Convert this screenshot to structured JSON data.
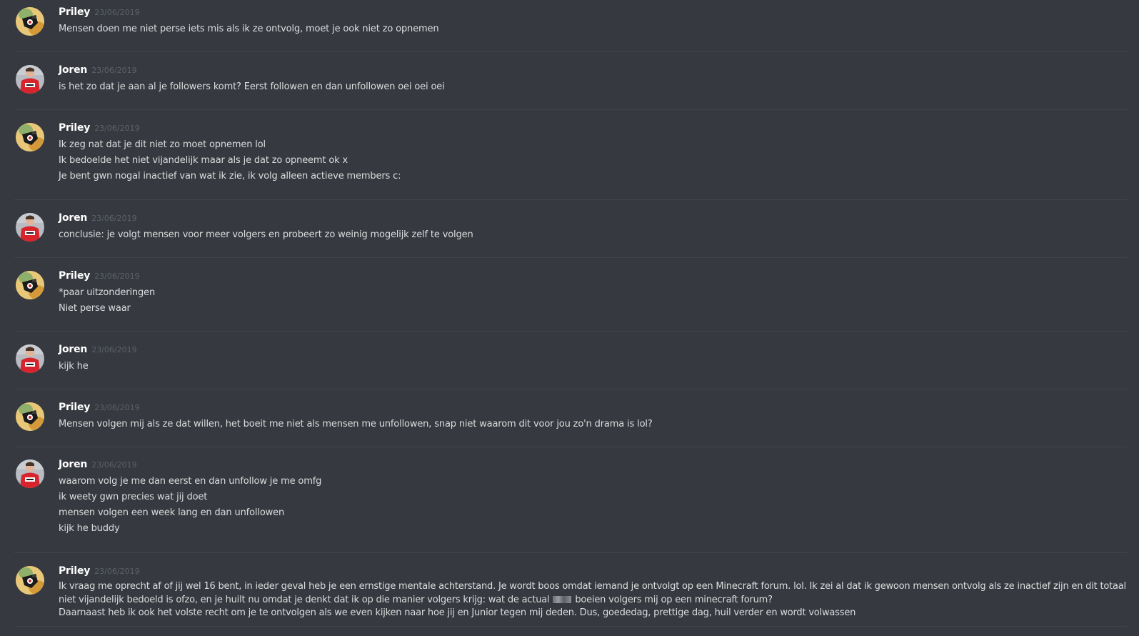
{
  "messages": [
    {
      "author": "Priley",
      "avatar": "priley-avatar",
      "timestamp": "23/06/2019",
      "lines": [
        "Mensen doen me niet perse iets mis als ik ze ontvolg, moet je ook niet zo opnemen"
      ]
    },
    {
      "author": "Joren",
      "avatar": "joren-avatar",
      "timestamp": "23/06/2019",
      "lines": [
        "is het zo dat je aan al je followers komt? Eerst followen en dan unfollowen oei oei oei"
      ]
    },
    {
      "author": "Priley",
      "avatar": "priley-avatar",
      "timestamp": "23/06/2019",
      "lines": [
        "Ik zeg nat dat je dit niet zo moet opnemen lol",
        "Ik bedoelde het niet vijandelijk maar als je dat zo opneemt ok x",
        "Je bent gwn nogal inactief van wat ik zie, ik volg alleen actieve members c:"
      ]
    },
    {
      "author": "Joren",
      "avatar": "joren-avatar",
      "timestamp": "23/06/2019",
      "lines": [
        "conclusie: je volgt mensen voor meer volgers en probeert zo weinig mogelijk zelf te volgen"
      ]
    },
    {
      "author": "Priley",
      "avatar": "priley-avatar",
      "timestamp": "23/06/2019",
      "lines": [
        "*paar uitzonderingen",
        "Niet perse waar"
      ]
    },
    {
      "author": "Joren",
      "avatar": "joren-avatar",
      "timestamp": "23/06/2019",
      "lines": [
        "kijk he"
      ]
    },
    {
      "author": "Priley",
      "avatar": "priley-avatar",
      "timestamp": "23/06/2019",
      "lines": [
        "Mensen volgen mij als ze dat willen, het boeit me niet als mensen me unfollowen,  snap niet waarom dit voor jou zo'n drama is lol?"
      ]
    },
    {
      "author": "Joren",
      "avatar": "joren-avatar",
      "timestamp": "23/06/2019",
      "lines": [
        "waarom volg je me dan eerst en dan unfollow je me omfg",
        "ik weety gwn precies wat jij doet",
        "mensen volgen een week lang en dan unfollowen",
        "kijk he buddy"
      ]
    },
    {
      "author": "Priley",
      "avatar": "priley-avatar",
      "timestamp": "23/06/2019",
      "long_line_1": "Ik vraag me oprecht af of jij wel 16 bent, in ieder geval heb je een ernstige mentale achterstand. Je wordt boos omdat iemand je ontvolgt op een Minecraft forum. lol. Ik zei al dat ik gewoon mensen ontvolg als ze inactief zijn en dit totaal",
      "long_line_2_before": "niet vijandelijk bedoeld is ofzo, en je huilt nu omdat je denkt dat ik op die manier volgers krijg: wat de actual",
      "long_line_2_after": "boeien volgers mij op een minecraft forum?",
      "long_line_3": "Daarnaast heb ik ook het volste recht om je te ontvolgen als we even kijken naar hoe jij en Junior tegen mij deden. Dus, goededag, prettige dag, huil verder en wordt volwassen"
    }
  ],
  "colors": {
    "background": "#36393f",
    "username": "#ffffff",
    "timestamp": "#5d6169",
    "text": "#dcddde",
    "divider": "#40434a"
  }
}
